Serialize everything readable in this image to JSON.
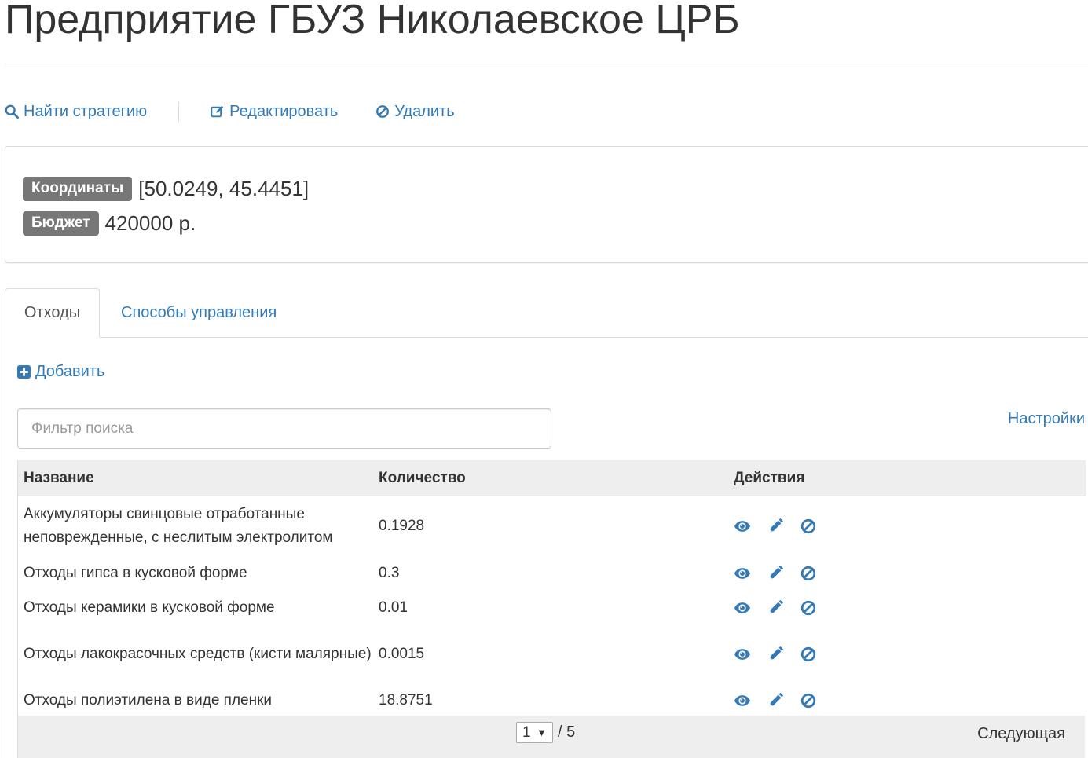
{
  "page": {
    "title": "Предприятие ГБУЗ Николаевское ЦРБ"
  },
  "actions": {
    "find_strategy": "Найти стратегию",
    "edit": "Редактировать",
    "delete": "Удалить"
  },
  "properties": {
    "coordinates_label": "Координаты",
    "coordinates_value": "[50.0249, 45.4451]",
    "budget_label": "Бюджет",
    "budget_value": "420000 р."
  },
  "tabs": [
    {
      "label": "Отходы",
      "active": true
    },
    {
      "label": "Способы управления",
      "active": false
    }
  ],
  "waste": {
    "add_label": "Добавить",
    "search_placeholder": "Фильтр поиска",
    "settings_label": "Настройки",
    "columns": [
      "Название",
      "Количество",
      "Действия"
    ],
    "rows": [
      {
        "name": "Аккумуляторы свинцовые отработанные неповрежденные, с неслитым электролитом",
        "qty": "0.1928"
      },
      {
        "name": "Отходы гипса в кусковой форме",
        "qty": "0.3"
      },
      {
        "name": "Отходы керамики в кусковой форме",
        "qty": "0.01"
      },
      {
        "name": "Отходы лакокрасочных средств (кисти малярные)",
        "qty": "0.0015"
      },
      {
        "name": "Отходы полиэтилена в виде пленки",
        "qty": "18.8751"
      }
    ],
    "pagination": {
      "current": "1",
      "total": "/ 5",
      "next": "Следующая"
    }
  },
  "icons": {
    "search": "search-icon",
    "edit": "edit-icon",
    "delete": "ban-icon",
    "add": "plus-square-icon",
    "view": "eye-icon",
    "pencil": "pencil-icon"
  },
  "colors": {
    "link": "#337ab7",
    "badge": "#777777",
    "header_bg": "#eeeeee"
  }
}
